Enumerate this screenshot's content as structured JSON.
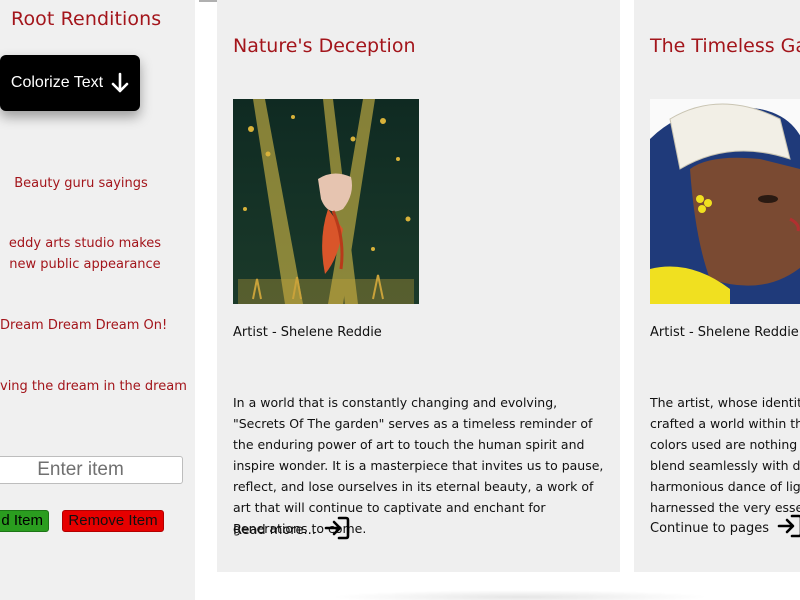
{
  "sidebar": {
    "title": "Root Renditions",
    "colorize_label": "Colorize Text",
    "links": [
      "Beauty guru sayings",
      "eddy arts studio makes new public appearance",
      "Dream Dream Dream On!",
      "ving the dream in the dream"
    ],
    "input_placeholder": "Enter item",
    "add_label": "d Item",
    "remove_label": "Remove Item"
  },
  "cards": [
    {
      "title": "Nature's Deception",
      "artist": "Artist - Shelene Reddie",
      "description": "In a world that is constantly changing and evolving, \"Secrets Of The garden\" serves as a timeless reminder of the enduring power of art to touch the human spirit and inspire wonder. It is a masterpiece that invites us to pause, reflect, and lose ourselves in its eternal beauty, a work of art that will continue to captivate and enchant for generations to come.",
      "link_label": "Read more..."
    },
    {
      "title": "The Timeless Gal",
      "artist": "Artist - Shelene Reddie",
      "description_lines": [
        "The artist, whose identity",
        "crafted a world within th",
        "colors used are nothing s",
        "blend seamlessly with de",
        "harmonious dance of lig",
        "harnessed the very esse"
      ],
      "link_label": "Continue to pages"
    }
  ],
  "colors": {
    "accent": "#a3151b",
    "panel": "#efefef",
    "add_button": "#2a9d1f",
    "remove_button": "#e60000"
  }
}
